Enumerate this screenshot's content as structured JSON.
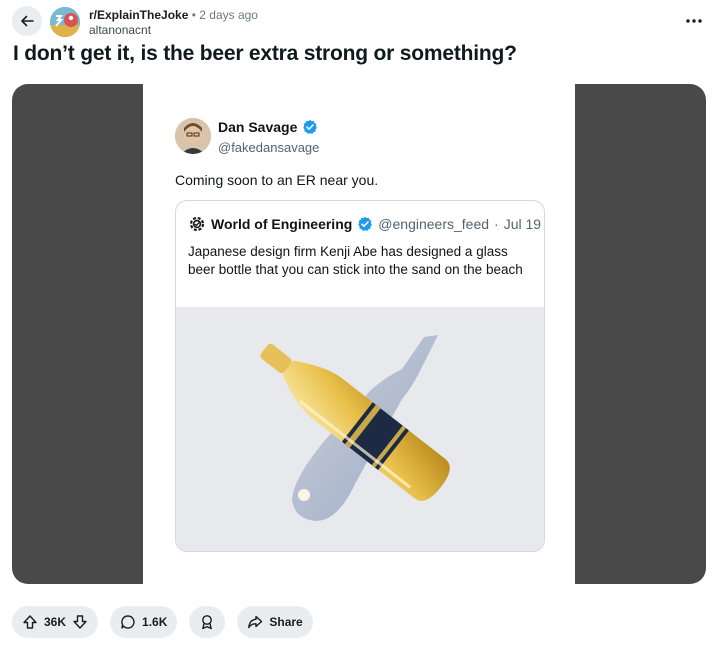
{
  "post": {
    "subreddit": "r/ExplainTheJoke",
    "separator": "•",
    "time": "2 days ago",
    "author": "altanonacnt",
    "title": "I don’t get it, is the beer extra strong or something?"
  },
  "tweet": {
    "name": "Dan Savage",
    "handle": "@fakedansavage",
    "text": "Coming soon to an ER near you.",
    "quote": {
      "name": "World of Engineering",
      "handle": "@engineers_feed",
      "separator": "·",
      "date": "Jul 19",
      "text": "Japanese design firm Kenji Abe has designed a glass beer bottle that you can stick into the sand on the beach"
    }
  },
  "actions": {
    "upvotes": "36K",
    "comments": "1.6K",
    "share": "Share"
  },
  "icons": {
    "back": "arrow-left-icon",
    "more": "ellipsis-icon",
    "verified": "verified-badge-icon",
    "upvote": "arrow-up-icon",
    "downvote": "arrow-down-icon",
    "comment": "speech-bubble-icon",
    "award": "award-icon",
    "share": "share-arrow-icon"
  },
  "colors": {
    "verified": "#1d9bf0",
    "pill_bg": "#eaedef",
    "media_bg": "#494949"
  }
}
